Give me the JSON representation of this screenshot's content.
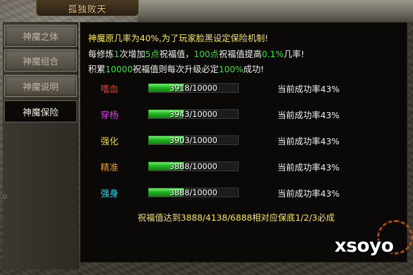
{
  "window": {
    "title": "孤独败天"
  },
  "sidebar": {
    "items": [
      {
        "label": "神魔之体",
        "active": false
      },
      {
        "label": "神魔组合",
        "active": false
      },
      {
        "label": "神魔说明",
        "active": false
      },
      {
        "label": "神魔保险",
        "active": true
      }
    ],
    "edge_mark": "D"
  },
  "info": {
    "line1": "神魔原几率为40%,为了玩家脸黑设定保险机制!",
    "line2": {
      "p1": "每修炼",
      "n1": "1",
      "p2": "次增加",
      "n2": "5点",
      "p3": "祝福值，",
      "n3": "100点",
      "p4": "祝福值提高",
      "n4": "0.1%",
      "p5": "几率!"
    },
    "line3": {
      "p1": "积累",
      "n1": "10000",
      "p2": "祝福值则每次升级必定",
      "n2": "100%",
      "p3": "成功!"
    }
  },
  "attributes": [
    {
      "name": "嗜血",
      "color": "#e63a2a",
      "progress_text": "3918/10000",
      "current": 3918,
      "max": 10000,
      "rate_text": "当前成功率43%"
    },
    {
      "name": "穿杨",
      "color": "#cc44d8",
      "progress_text": "3943/10000",
      "current": 3943,
      "max": 10000,
      "rate_text": "当前成功率43%"
    },
    {
      "name": "强化",
      "color": "#e8d24a",
      "progress_text": "3903/10000",
      "current": 3903,
      "max": 10000,
      "rate_text": "当前成功率43%"
    },
    {
      "name": "精准",
      "color": "#e09a3a",
      "progress_text": "3888/10000",
      "current": 3888,
      "max": 10000,
      "rate_text": "当前成功率43%"
    },
    {
      "name": "强身",
      "color": "#33d2e0",
      "progress_text": "3888/10000",
      "current": 3888,
      "max": 10000,
      "rate_text": "当前成功率43%"
    }
  ],
  "footer": {
    "note": "祝福值达到3888/4138/6888相对应保底1/2/3必成"
  },
  "watermark": {
    "text": "xsoyo"
  },
  "colors": {
    "highlight_yellow": "#f6e85a",
    "highlight_green": "#38e038",
    "bar_green": "#22b322"
  }
}
